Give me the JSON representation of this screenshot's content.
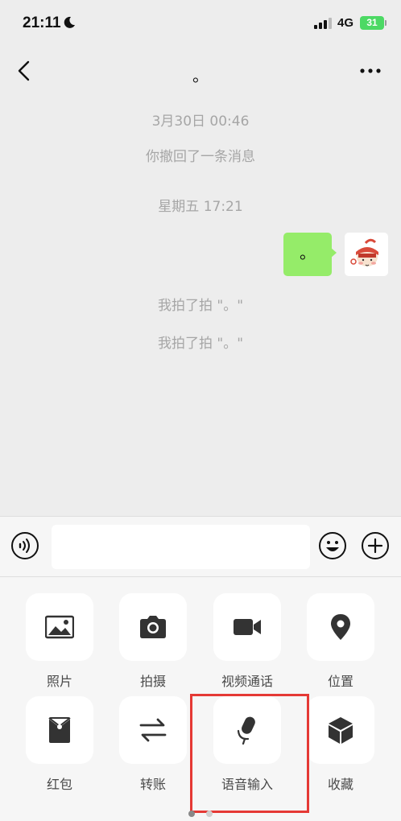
{
  "status_bar": {
    "time": "21:11",
    "network": "4G",
    "battery": "31"
  },
  "nav": {
    "title": "。"
  },
  "chat": {
    "timestamp1": "3月30日 00:46",
    "recall_notice": "你撤回了一条消息",
    "timestamp2": "星期五 17:21",
    "sent_message": "。",
    "pat_notice_1": "我拍了拍 \"。\"",
    "pat_notice_2": "我拍了拍 \"。\""
  },
  "panel": {
    "items": [
      {
        "label": "照片",
        "icon": "photo-icon"
      },
      {
        "label": "拍摄",
        "icon": "camera-icon"
      },
      {
        "label": "视频通话",
        "icon": "video-call-icon"
      },
      {
        "label": "位置",
        "icon": "location-icon"
      },
      {
        "label": "红包",
        "icon": "red-packet-icon"
      },
      {
        "label": "转账",
        "icon": "transfer-icon"
      },
      {
        "label": "语音输入",
        "icon": "microphone-icon"
      },
      {
        "label": "收藏",
        "icon": "favorites-icon"
      }
    ]
  },
  "colors": {
    "accent_bubble": "#95ec69",
    "highlight_box": "#e53935",
    "background": "#ededed"
  }
}
